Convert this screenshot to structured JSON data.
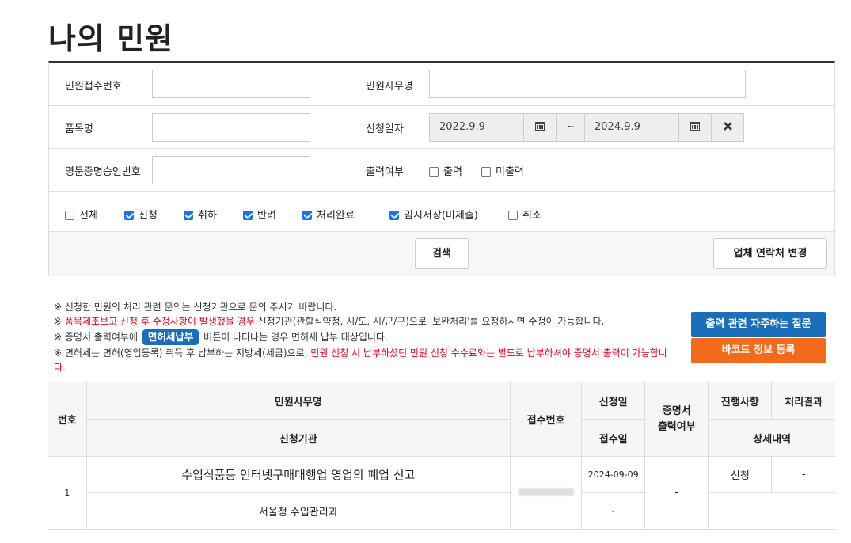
{
  "page_title": "나의 민원",
  "search": {
    "receipt_no_label": "민원접수번호",
    "receipt_no_value": "",
    "service_name_label": "민원사무명",
    "service_name_value": "",
    "product_label": "품목명",
    "product_value": "",
    "apply_date_label": "신청일자",
    "date_from": "2022.9.9",
    "date_sep": "~",
    "date_to": "2024.9.9",
    "eng_cert_label": "영문증명승인번호",
    "eng_cert_value": "",
    "print_label": "출력여부",
    "print_options": [
      {
        "label": "출력",
        "checked": false
      },
      {
        "label": "미출력",
        "checked": false
      }
    ],
    "status_options": [
      {
        "label": "전체",
        "checked": false
      },
      {
        "label": "신청",
        "checked": true
      },
      {
        "label": "취하",
        "checked": true
      },
      {
        "label": "반려",
        "checked": true
      },
      {
        "label": "처리완료",
        "checked": true
      },
      {
        "label": "임시저장(미제출)",
        "checked": true
      },
      {
        "label": "취소",
        "checked": false
      }
    ],
    "search_button": "검색",
    "contact_button": "업체 연락처 변경"
  },
  "notes": {
    "n1": "※ 신청한 민원의 처리 관련 문의는 신청기관으로 문의 주시기 바랍니다.",
    "n2_prefix": "※ ",
    "n2_red": "품목제조보고 신청 후 수정사항이 발생했을 경우",
    "n2_rest": " 신청기관(관할식약청, 시/도, 시/군/구)으로 '보완처리'를 요청하시면 수정이 가능합니다.",
    "n3_prefix": "※ 증명서 출력여부에 ",
    "n3_pill": "면허세납부",
    "n3_rest": " 버튼이 나타나는 경우 면허세 납부 대상입니다.",
    "n4_prefix": "※ 면허세는 면허(영업등록) 취득 후 납부하는 지방세(세금)으로, ",
    "n4_red": "민원 신청 시 납부하셨던 민원 신청 수수료와는 별도로 납부하셔야 증명서 출력이 가능합니다."
  },
  "side_buttons": {
    "faq": "출력 관련 자주하는 질문",
    "barcode": "바코드 정보 등록",
    "faq_color": "#1a6fb8",
    "barcode_color": "#f26b1d"
  },
  "table": {
    "headers": {
      "no": "번호",
      "service": "민원사무명",
      "agency": "신청기관",
      "receipt": "접수번호",
      "apply_date": "신청일",
      "receive_date": "접수일",
      "cert": "증명서 출력여부",
      "progress": "진행사항",
      "result": "처리결과",
      "detail": "상세내역"
    },
    "rows": [
      {
        "no": "1",
        "service": "수입식품등 인터넷구매대행업 영업의 폐업 신고",
        "agency": "서울청 수입관리과",
        "apply_date": "2024-09-09",
        "receive_date": "-",
        "cert": "-",
        "progress": "신청",
        "result": "-"
      }
    ]
  }
}
